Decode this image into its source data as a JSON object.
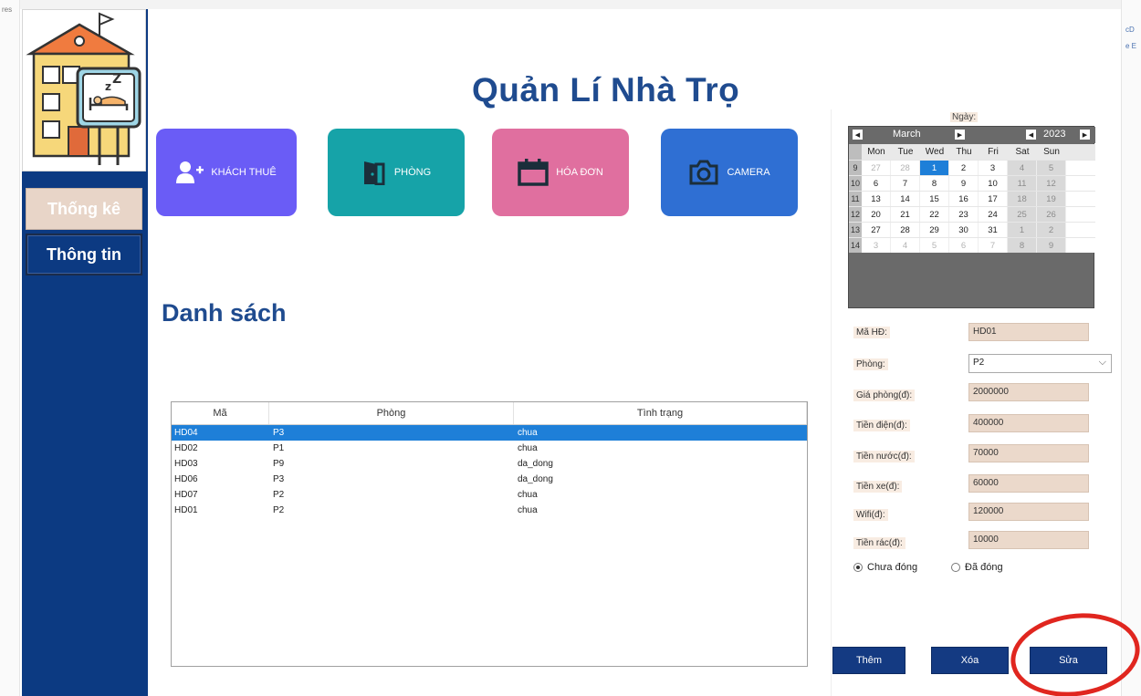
{
  "edge": {
    "left_fragment": "res",
    "right_fragments": [
      "cD",
      "e E"
    ]
  },
  "app": {
    "title": "Quản Lí Nhà Trọ",
    "sidebar": {
      "items": [
        {
          "label": "Thống kê"
        },
        {
          "label": "Thông tin"
        }
      ]
    },
    "tiles": [
      {
        "label": "KHÁCH THUÊ",
        "icon": "add-person-icon",
        "color": "#6a5cf6"
      },
      {
        "label": "PHÒNG",
        "icon": "door-icon",
        "color": "#16a3a8"
      },
      {
        "label": "HÓA ĐƠN",
        "icon": "calendar-icon",
        "color": "#e06f9f"
      },
      {
        "label": "CAMERA",
        "icon": "camera-icon",
        "color": "#2f6fd3"
      }
    ],
    "list": {
      "title": "Danh sách",
      "columns": [
        "Mã",
        "Phòng",
        "Tình trạng"
      ],
      "rows": [
        {
          "ma": "HD04",
          "phong": "P3",
          "tinh_trang": "chua",
          "selected": true
        },
        {
          "ma": "HD02",
          "phong": "P1",
          "tinh_trang": "chua"
        },
        {
          "ma": "HD03",
          "phong": "P9",
          "tinh_trang": "da_dong"
        },
        {
          "ma": "HD06",
          "phong": "P3",
          "tinh_trang": "da_dong"
        },
        {
          "ma": "HD07",
          "phong": "P2",
          "tinh_trang": "chua"
        },
        {
          "ma": "HD01",
          "phong": "P2",
          "tinh_trang": "chua"
        }
      ]
    },
    "form": {
      "date_label": "Ngày:",
      "calendar": {
        "month": "March",
        "year": "2023",
        "weekdays": [
          "Mon",
          "Tue",
          "Wed",
          "Thu",
          "Fri",
          "Sat",
          "Sun"
        ],
        "weeks": [
          {
            "num": "9",
            "days": [
              "27",
              "28",
              "1",
              "2",
              "3",
              "4",
              "5"
            ]
          },
          {
            "num": "10",
            "days": [
              "6",
              "7",
              "8",
              "9",
              "10",
              "11",
              "12"
            ]
          },
          {
            "num": "11",
            "days": [
              "13",
              "14",
              "15",
              "16",
              "17",
              "18",
              "19"
            ]
          },
          {
            "num": "12",
            "days": [
              "20",
              "21",
              "22",
              "23",
              "24",
              "25",
              "26"
            ]
          },
          {
            "num": "13",
            "days": [
              "27",
              "28",
              "29",
              "30",
              "31",
              "1",
              "2"
            ]
          },
          {
            "num": "14",
            "days": [
              "3",
              "4",
              "5",
              "6",
              "7",
              "8",
              "9"
            ]
          }
        ],
        "selected_day": "1"
      },
      "fields": {
        "ma_hd": {
          "label": "Mã HĐ:",
          "value": "HD01"
        },
        "phong": {
          "label": "Phòng:",
          "value": "P2"
        },
        "gia_phong": {
          "label": "Giá phòng(đ):",
          "value": "2000000"
        },
        "tien_dien": {
          "label": "Tiền điện(đ):",
          "value": "400000"
        },
        "tien_nuoc": {
          "label": "Tiền nước(đ):",
          "value": "70000"
        },
        "tien_xe": {
          "label": "Tiền xe(đ):",
          "value": "60000"
        },
        "wifi": {
          "label": "Wifi(đ):",
          "value": "120000"
        },
        "tien_rac": {
          "label": "Tiền rác(đ):",
          "value": "10000"
        }
      },
      "status": {
        "chua_dong": "Chưa đóng",
        "da_dong": "Đã đóng",
        "selected": "chua_dong"
      },
      "buttons": {
        "them": "Thêm",
        "xoa": "Xóa",
        "sua": "Sửa"
      }
    },
    "colors": {
      "sidebar": "#0c3a82",
      "title": "#1f4b8f",
      "selection": "#1e7fd8",
      "annotation": "#e0261f"
    }
  }
}
